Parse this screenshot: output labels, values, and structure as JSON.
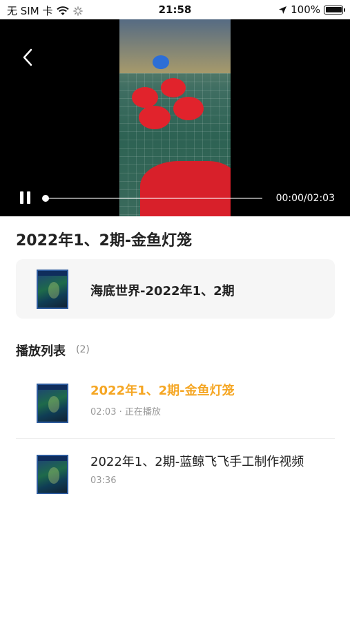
{
  "status": {
    "carrier": "无 SIM 卡",
    "time": "21:58",
    "battery": "100%"
  },
  "player": {
    "current_time": "00:00/02:03",
    "progress": 0
  },
  "video": {
    "title": "2022年1、2期-金鱼灯笼"
  },
  "album": {
    "title": "海底世界-2022年1、2期"
  },
  "playlist": {
    "heading": "播放列表",
    "count": "(2)",
    "items": [
      {
        "title": "2022年1、2期-金鱼灯笼",
        "meta": "02:03 · 正在播放",
        "active": true
      },
      {
        "title": "2022年1、2期-蓝鲸飞飞手工制作视频",
        "meta": "03:36",
        "active": false
      }
    ]
  },
  "colors": {
    "accent": "#f5a623",
    "player_bg": "#000000",
    "card_bg": "#f6f6f6"
  }
}
